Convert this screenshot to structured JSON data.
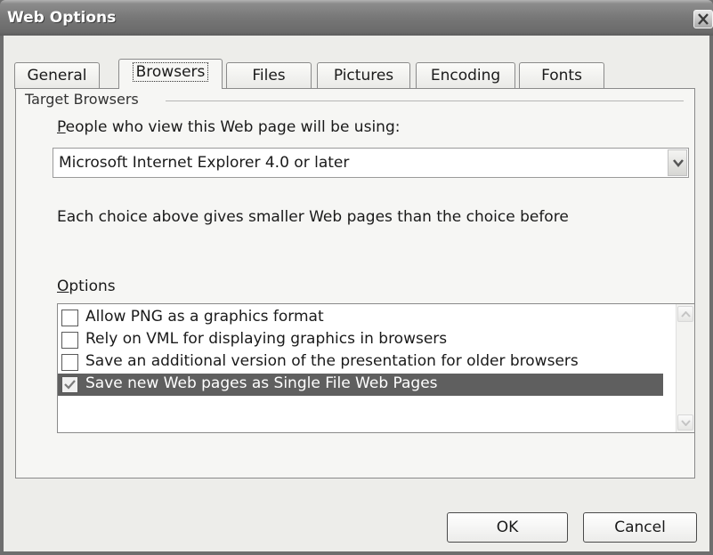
{
  "window": {
    "title": "Web Options"
  },
  "tabs": [
    {
      "label": "General"
    },
    {
      "label": "Browsers"
    },
    {
      "label": "Files"
    },
    {
      "label": "Pictures"
    },
    {
      "label": "Encoding"
    },
    {
      "label": "Fonts"
    }
  ],
  "active_tab": "Browsers",
  "target_browsers": {
    "group_label": "Target Browsers",
    "people_label_accel": "P",
    "people_label_rest": "eople who view this Web page will be using:",
    "selected_browser": "Microsoft Internet Explorer 4.0 or later",
    "hint": "Each choice above gives smaller Web pages than the choice before"
  },
  "options": {
    "label_accel": "O",
    "label_rest": "ptions",
    "items": [
      {
        "label": "Allow PNG as a graphics format",
        "checked": false,
        "selected": false
      },
      {
        "label": "Rely on VML for displaying graphics in browsers",
        "checked": false,
        "selected": false
      },
      {
        "label": "Save an additional version of the presentation for older browsers",
        "checked": false,
        "selected": false
      },
      {
        "label": "Save new Web pages as Single File Web Pages",
        "checked": true,
        "selected": true
      }
    ]
  },
  "buttons": {
    "ok": "OK",
    "cancel": "Cancel"
  },
  "icons": {
    "close": "close-icon",
    "dropdown": "chevron-down-icon",
    "checkmark": "checkmark-icon",
    "scroll_up": "scroll-up-icon",
    "scroll_down": "scroll-down-icon"
  }
}
